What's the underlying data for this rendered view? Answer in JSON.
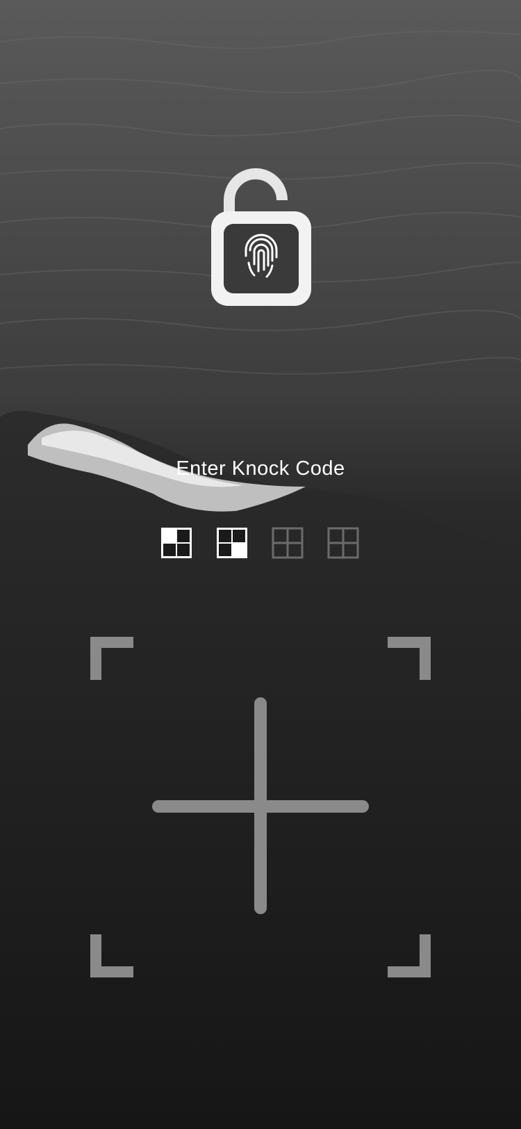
{
  "wallpaper": {
    "description_icon": "ocean-wave-wallpaper"
  },
  "lock": {
    "icon": "padlock-open-fingerprint-icon"
  },
  "prompt": {
    "title": "Enter Knock Code"
  },
  "progress": {
    "entered": 2,
    "total": 4,
    "taps": [
      {
        "quadrant": "top-left",
        "state": "filled"
      },
      {
        "quadrant": "bottom-right",
        "state": "filled"
      },
      {
        "quadrant": "",
        "state": "empty"
      },
      {
        "quadrant": "",
        "state": "empty"
      }
    ]
  },
  "knock_pad": {
    "quadrants": [
      "top-left",
      "top-right",
      "bottom-left",
      "bottom-right"
    ]
  },
  "colors": {
    "text": "#ffffff",
    "active_dot": "#ffffff",
    "inactive_dot": "#6b6b6b",
    "pad_lines": "#8a8a8a"
  }
}
